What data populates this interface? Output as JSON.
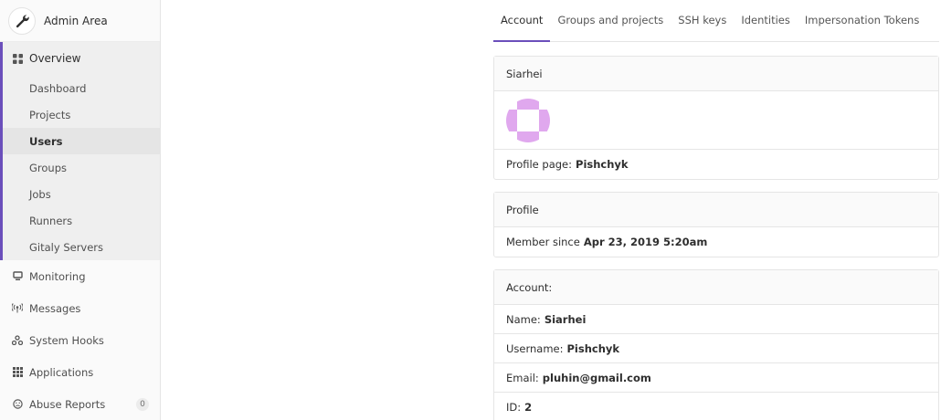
{
  "sidebar": {
    "title": "Admin Area",
    "overview": {
      "label": "Overview",
      "items": [
        {
          "label": "Dashboard"
        },
        {
          "label": "Projects"
        },
        {
          "label": "Users"
        },
        {
          "label": "Groups"
        },
        {
          "label": "Jobs"
        },
        {
          "label": "Runners"
        },
        {
          "label": "Gitaly Servers"
        }
      ]
    },
    "items": [
      {
        "label": "Monitoring",
        "icon": "monitor-icon"
      },
      {
        "label": "Messages",
        "icon": "broadcast-icon"
      },
      {
        "label": "System Hooks",
        "icon": "hook-icon"
      },
      {
        "label": "Applications",
        "icon": "apps-grid-icon"
      },
      {
        "label": "Abuse Reports",
        "icon": "abuse-icon",
        "badge": "0"
      }
    ]
  },
  "tabs": [
    {
      "label": "Account"
    },
    {
      "label": "Groups and projects"
    },
    {
      "label": "SSH keys"
    },
    {
      "label": "Identities"
    },
    {
      "label": "Impersonation Tokens"
    }
  ],
  "user_card": {
    "name": "Siarhei",
    "profile_label": "Profile page:",
    "profile_value": "Pishchyk"
  },
  "profile_card": {
    "title": "Profile",
    "member_label": "Member since",
    "member_value": "Apr 23, 2019 5:20am"
  },
  "account_card": {
    "title": "Account:",
    "rows": [
      {
        "label": "Name:",
        "value": "Siarhei"
      },
      {
        "label": "Username:",
        "value": "Pishchyk"
      },
      {
        "label": "Email:",
        "value": "pluhin@gmail.com"
      },
      {
        "label": "ID:",
        "value": "2"
      }
    ]
  },
  "colors": {
    "accent": "#6b4fbb",
    "identicon": "#e0a8ee"
  }
}
